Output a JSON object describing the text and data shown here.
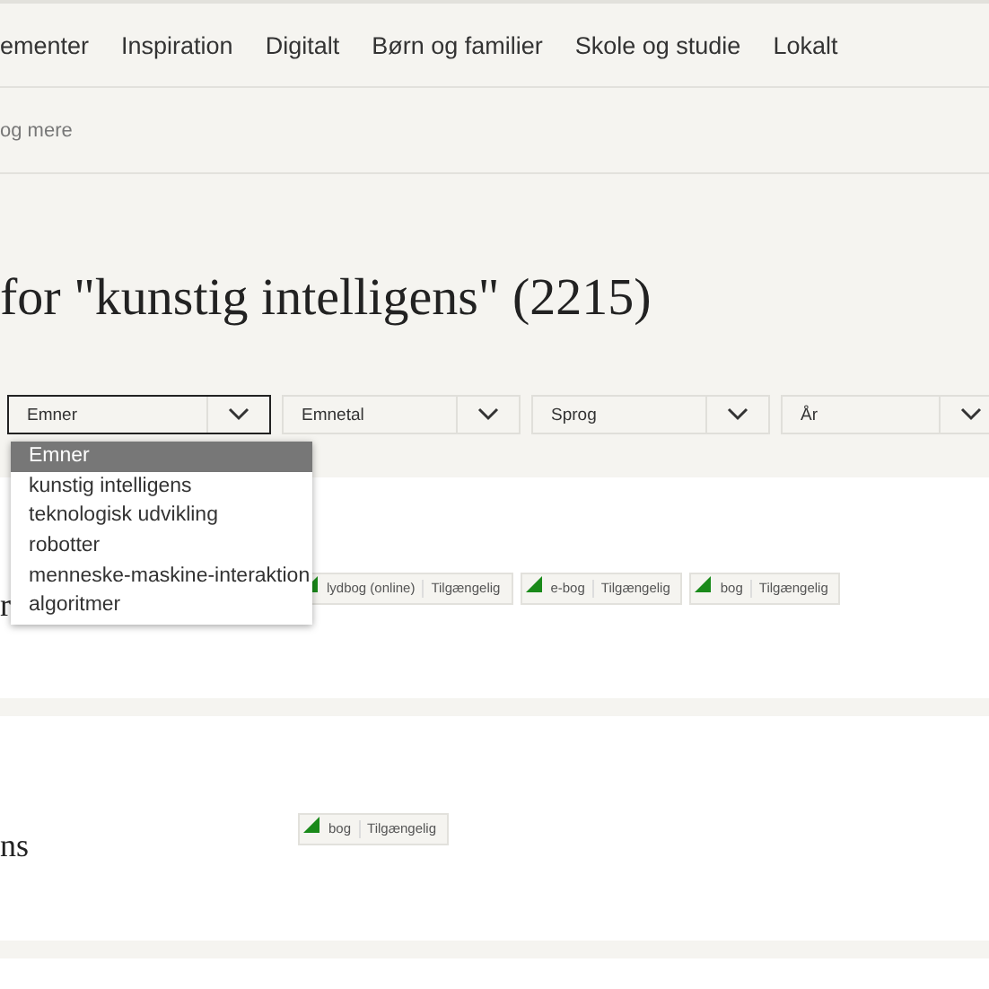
{
  "nav": {
    "items": [
      "ementer",
      "Inspiration",
      "Digitalt",
      "Børn og familier",
      "Skole og studie",
      "Lokalt"
    ]
  },
  "breadcrumb": "og mere",
  "heading": "for \"kunstig intelligens\" (2215)",
  "filters": [
    {
      "label": "Emner",
      "selected": true
    },
    {
      "label": "Emnetal",
      "selected": false
    },
    {
      "label": "Sprog",
      "selected": false
    },
    {
      "label": "År",
      "selected": false
    }
  ],
  "dropdown": {
    "options": [
      {
        "label": "Emner",
        "selected": true
      },
      {
        "label": "kunstig intelligens",
        "selected": false
      },
      {
        "label": "teknologisk udvikling",
        "selected": false
      },
      {
        "label": "robotter",
        "selected": false
      },
      {
        "label": "menneske-maskine-interaktion",
        "selected": false
      },
      {
        "label": "algoritmer",
        "selected": false
      }
    ]
  },
  "results": [
    {
      "title": "r",
      "badges": [
        {
          "format": "lydbog (online)",
          "status": "Tilgængelig",
          "available": true
        },
        {
          "format": "e-bog",
          "status": "Tilgængelig",
          "available": true
        },
        {
          "format": "bog",
          "status": "Tilgængelig",
          "available": true
        }
      ]
    },
    {
      "title": "ns",
      "badges": [
        {
          "format": "bog",
          "status": "Tilgængelig",
          "available": true
        }
      ]
    }
  ]
}
